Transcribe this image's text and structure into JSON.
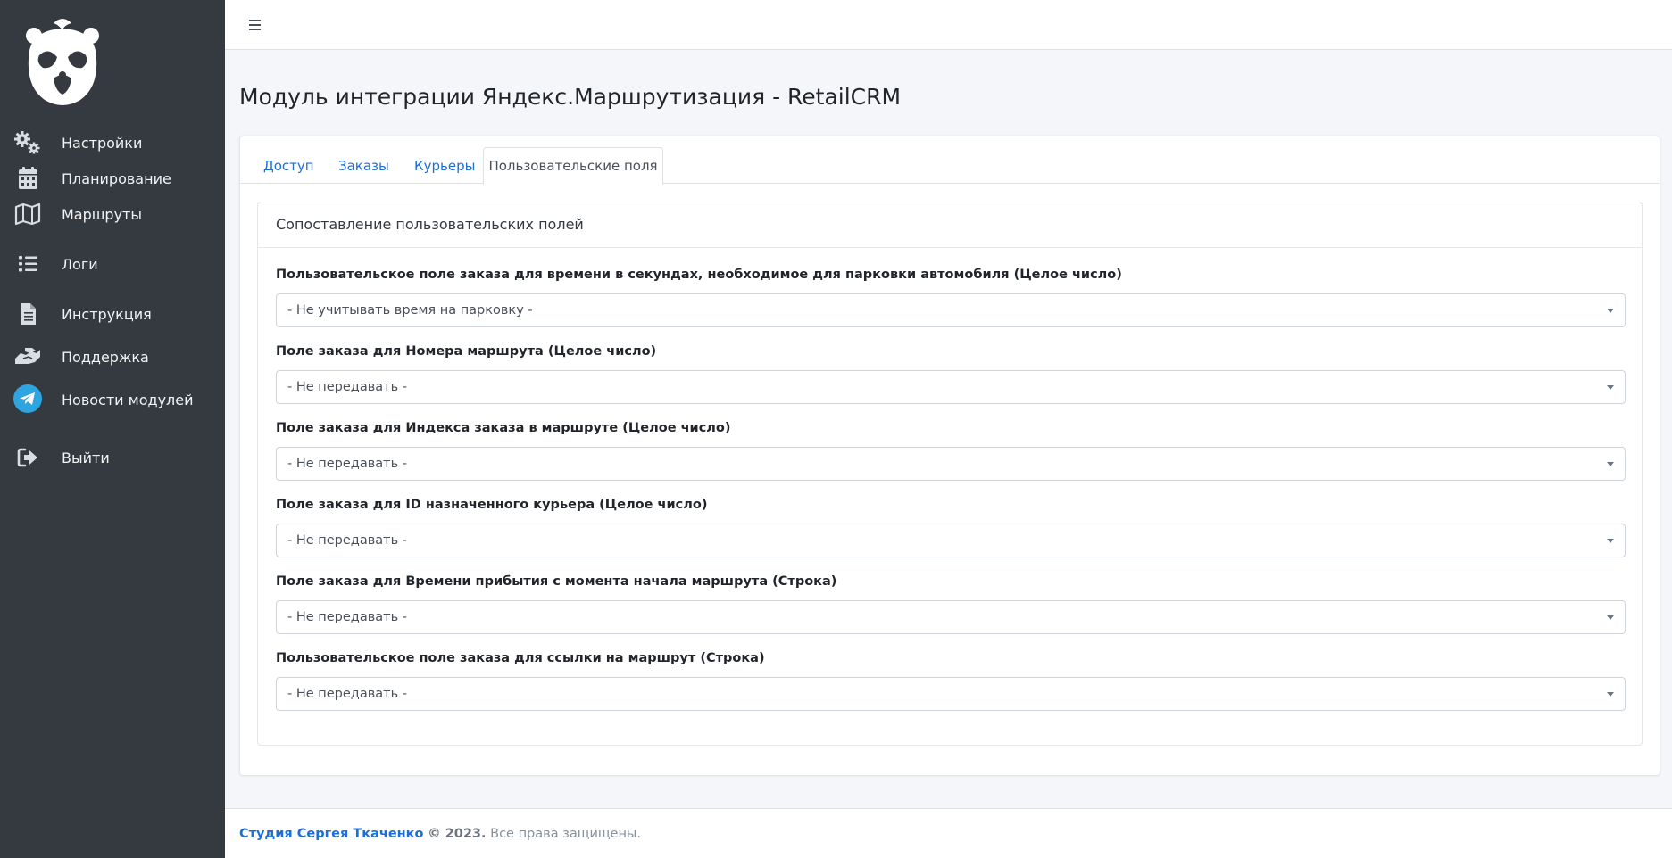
{
  "sidebar": {
    "items": [
      {
        "label": "Настройки",
        "icon": "gears-icon"
      },
      {
        "label": "Планирование",
        "icon": "calendar-icon"
      },
      {
        "label": "Маршруты",
        "icon": "map-icon"
      },
      {
        "label": "Логи",
        "icon": "list-icon"
      },
      {
        "label": "Инструкция",
        "icon": "document-icon"
      },
      {
        "label": "Поддержка",
        "icon": "handshake-icon"
      },
      {
        "label": "Новости модулей",
        "icon": "telegram-icon"
      },
      {
        "label": "Выйти",
        "icon": "logout-icon"
      }
    ]
  },
  "page": {
    "title": "Модуль интеграции Яндекс.Маршрутизация - RetailCRM"
  },
  "tabs": [
    {
      "label": "Доступ",
      "active": false
    },
    {
      "label": "Заказы",
      "active": false
    },
    {
      "label": "Курьеры",
      "active": false
    },
    {
      "label": "Пользовательские поля",
      "active": true
    }
  ],
  "section": {
    "title": "Сопоставление пользовательских полей",
    "fields": [
      {
        "label": "Пользовательское поле заказа для времени в секундах, необходимое для парковки автомобиля (Целое число)",
        "value": "- Не учитывать время на парковку -"
      },
      {
        "label": "Поле заказа для Номера маршрута (Целое число)",
        "value": "- Не передавать -"
      },
      {
        "label": "Поле заказа для Индекса заказа в маршруте (Целое число)",
        "value": "- Не передавать -"
      },
      {
        "label": "Поле заказа для ID назначенного курьера (Целое число)",
        "value": "- Не передавать -"
      },
      {
        "label": "Поле заказа для Времени прибытия с момента начала маршрута (Строка)",
        "value": "- Не передавать -"
      },
      {
        "label": "Пользовательское поле заказа для ссылки на маршрут (Строка)",
        "value": "- Не передавать -"
      }
    ]
  },
  "footer": {
    "link": "Студия Сергея Ткаченко",
    "copyright": "© 2023.",
    "rights": "Все права защищены."
  },
  "colors": {
    "sidebar_bg": "#343a40",
    "link": "#1d6fd8",
    "telegram": "#2ca5e0"
  }
}
